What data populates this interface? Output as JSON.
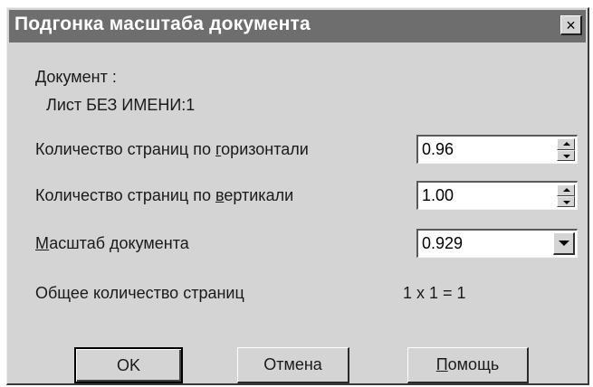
{
  "dialog": {
    "title": "Подгонка масштаба документа",
    "close_glyph": "×"
  },
  "document": {
    "label": "Документ :",
    "name": "Лист БЕЗ ИМЕНИ:1"
  },
  "fields": {
    "horizontal": {
      "label_before": "Количество страниц по ",
      "label_accel": "г",
      "label_after": "оризонтали",
      "value": "0.96"
    },
    "vertical": {
      "label_before": "Количество страниц по ",
      "label_accel": "в",
      "label_after": "ертикали",
      "value": "1.00"
    },
    "scale": {
      "label_accel": "М",
      "label_after": "асштаб документа",
      "value": "0.929"
    }
  },
  "total": {
    "label": "Общее количество страниц",
    "value": "1 x 1 = 1"
  },
  "buttons": {
    "ok": "OK",
    "cancel": "Отмена",
    "help_accel": "П",
    "help_rest": "омощь"
  }
}
